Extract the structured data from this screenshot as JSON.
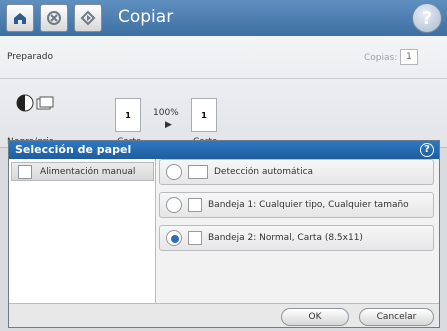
{
  "header": {
    "title": "Copiar",
    "help_symbol": "?"
  },
  "status": {
    "state": "Preparado",
    "copies_label": "Copias:",
    "copies_value": "1"
  },
  "settings": {
    "mode_label": "Negro/gris",
    "zoom_label": "100%",
    "doc_left_label": "Carta",
    "doc_right_label": "Carta",
    "doc_left_count": "1",
    "doc_right_count": "1"
  },
  "dialog": {
    "title": "Selección de papel",
    "manual_feed_label": "Alimentación manual",
    "options": [
      {
        "label": "Detección automática",
        "selected": false,
        "icon": "auto-detect-icon"
      },
      {
        "label": "Bandeja 1: Cualquier tipo, Cualquier tamaño",
        "selected": false,
        "icon": "tray-icon"
      },
      {
        "label": "Bandeja 2: Normal, Carta (8.5x11)",
        "selected": true,
        "icon": "tray-icon"
      }
    ],
    "ok_label": "OK",
    "cancel_label": "Cancelar"
  },
  "icons": {
    "home": "home-icon",
    "stop": "stop-icon",
    "start": "start-icon",
    "help": "help-icon"
  },
  "colors": {
    "header": "#3d6fa2",
    "dialog_header": "#1f5d9d",
    "selection_dot": "#2f6db1"
  }
}
